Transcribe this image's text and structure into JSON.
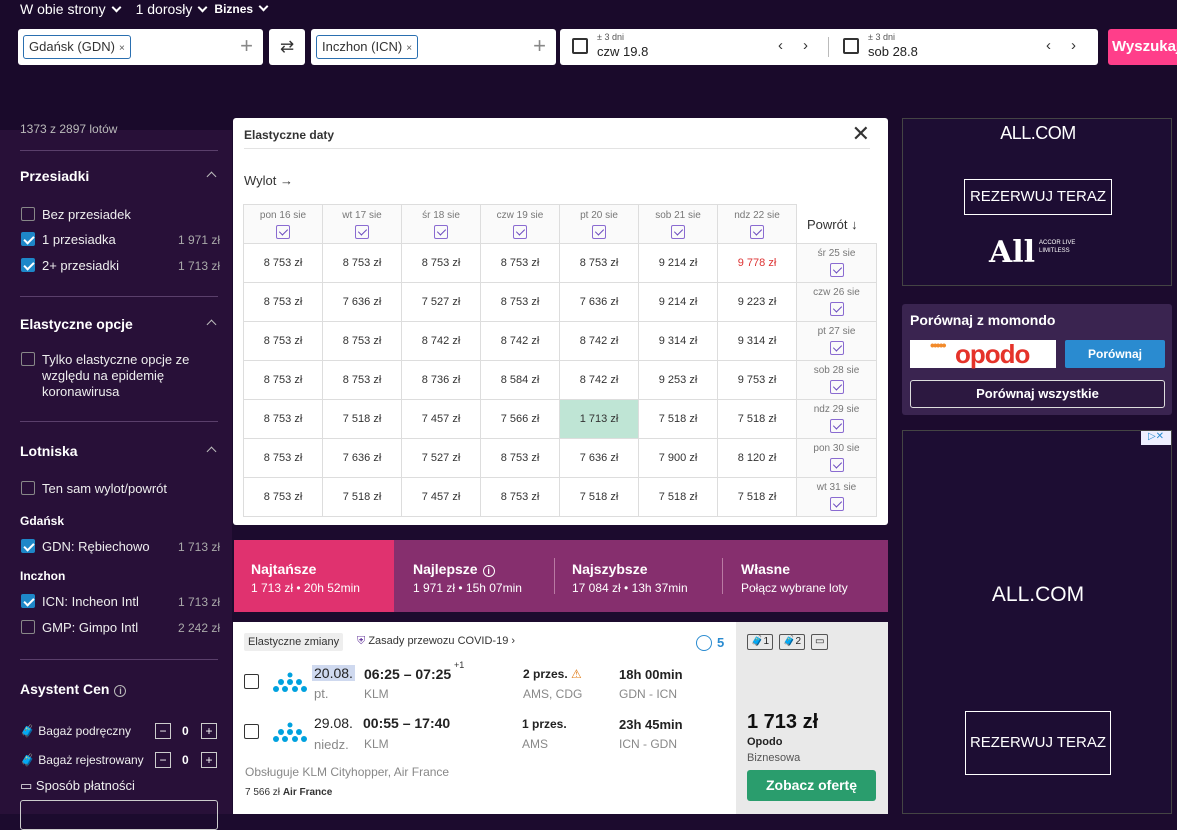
{
  "top": {
    "trip_type": "W obie strony",
    "passengers": "1 dorosły",
    "cabin": "Biznes",
    "origin": "Gdańsk (GDN)",
    "destination": "Inczhon (ICN)",
    "depart_flex": "± 3 dni",
    "depart_date": "czw 19.8",
    "return_flex": "± 3 dni",
    "return_date": "sob 28.8",
    "search_label": "Wyszukaj",
    "remove": "×",
    "add": "+",
    "swap": "⇄",
    "prev": "‹",
    "next": "›"
  },
  "sidebar": {
    "count": "1373 z 2897 lotów",
    "stops_title": "Przesiadki",
    "stops": [
      {
        "label": "Bez przesiadek",
        "price": "",
        "checked": false
      },
      {
        "label": "1 przesiadka",
        "price": "1 971 zł",
        "checked": true
      },
      {
        "label": "2+ przesiadki",
        "price": "1 713 zł",
        "checked": true
      }
    ],
    "flex_title": "Elastyczne opcje",
    "flex_label": "Tylko elastyczne opcje ze względu na epidemię koronawirusa",
    "airports_title": "Lotniska",
    "same_airport": "Ten sam wylot/powrót",
    "gdansk": "Gdańsk",
    "gdn": {
      "label": "GDN: Rębiechowo",
      "price": "1 713 zł"
    },
    "inczhon": "Inczhon",
    "icn": {
      "label": "ICN: Incheon Intl",
      "price": "1 713 zł"
    },
    "gmp": {
      "label": "GMP: Gimpo Intl",
      "price": "2 242 zł"
    },
    "assist_title": "Asystent Cen",
    "info": "i",
    "cabin_bag": "Bagaż podręczny",
    "checked_bag": "Bagaż rejestrowany",
    "cabin_count": "0",
    "checked_count": "0",
    "minus": "−",
    "plus": "+",
    "payment": "Sposób płatności"
  },
  "flex": {
    "title": "Elastyczne daty",
    "close": "✕",
    "wylot": "Wylot →",
    "powrot": "Powrót ↓",
    "cols": [
      "pon 16 sie",
      "wt 17 sie",
      "śr 18 sie",
      "czw 19 sie",
      "pt 20 sie",
      "sob 21 sie",
      "ndz 22 sie"
    ],
    "rows": [
      {
        "label": "śr 25 sie",
        "cells": [
          "8 753 zł",
          "8 753 zł",
          "8 753 zł",
          "8 753 zł",
          "8 753 zł",
          "9 214 zł",
          "9 778 zł"
        ]
      },
      {
        "label": "czw 26 sie",
        "cells": [
          "8 753 zł",
          "7 636 zł",
          "7 527 zł",
          "8 753 zł",
          "7 636 zł",
          "9 214 zł",
          "9 223 zł"
        ]
      },
      {
        "label": "pt 27 sie",
        "cells": [
          "8 753 zł",
          "8 753 zł",
          "8 742 zł",
          "8 742 zł",
          "8 742 zł",
          "9 314 zł",
          "9 314 zł"
        ]
      },
      {
        "label": "sob 28 sie",
        "cells": [
          "8 753 zł",
          "8 753 zł",
          "8 736 zł",
          "8 584 zł",
          "8 742 zł",
          "9 253 zł",
          "9 753 zł"
        ]
      },
      {
        "label": "ndz 29 sie",
        "cells": [
          "8 753 zł",
          "7 518 zł",
          "7 457 zł",
          "7 566 zł",
          "1 713 zł",
          "7 518 zł",
          "7 518 zł"
        ]
      },
      {
        "label": "pon 30 sie",
        "cells": [
          "8 753 zł",
          "7 636 zł",
          "7 527 zł",
          "8 753 zł",
          "7 636 zł",
          "7 900 zł",
          "8 120 zł"
        ]
      },
      {
        "label": "wt 31 sie",
        "cells": [
          "8 753 zł",
          "7 518 zł",
          "7 457 zł",
          "8 753 zł",
          "7 518 zł",
          "7 518 zł",
          "7 518 zł"
        ]
      }
    ]
  },
  "sort": [
    {
      "title": "Najtańsze",
      "sub": "1 713 zł • 20h 52min"
    },
    {
      "title": "Najlepsze",
      "sub": "1 971 zł • 15h 07min"
    },
    {
      "title": "Najszybsze",
      "sub": "17 084 zł • 13h 37min"
    },
    {
      "title": "Własne",
      "sub": "Połącz wybrane loty"
    }
  ],
  "result": {
    "flex_tag": "Elastyczne zmiany",
    "covid": "Zasady przewozu COVID-19",
    "score": "5",
    "out": {
      "date": "20.08.",
      "day": "pt.",
      "time": "06:25 – 07:25",
      "plus": "+1",
      "airline": "KLM",
      "stops": "2 przes.",
      "via": "AMS, CDG",
      "duration": "18h 00min",
      "route": "GDN - ICN"
    },
    "ret": {
      "date": "29.08.",
      "day": "niedz.",
      "time": "00:55 – 17:40",
      "airline": "KLM",
      "stops": "1 przes.",
      "via": "AMS",
      "duration": "23h 45min",
      "route": "ICN - GDN"
    },
    "operated": "Obsługuje KLM Cityhopper, Air France",
    "alt_price": "7 566 zł",
    "alt_airline": "Air France",
    "bags": [
      "1",
      "2"
    ],
    "price": "1 713 zł",
    "provider": "Opodo",
    "cabin": "Biznesowa",
    "cta": "Zobacz ofertę",
    "warn": "⚠",
    "chev": "›"
  },
  "ads": {
    "logo": "ALL.COM",
    "book": "REZERWUJ TERAZ",
    "all_big": "All",
    "all_small": "ACCOR LIVE LIMITLESS",
    "adchoice": "▷✕",
    "compare_title": "Porównaj z momondo",
    "opodo": "opodo",
    "compare_btn": "Porównaj",
    "compare_all": "Porównaj wszystkie"
  }
}
